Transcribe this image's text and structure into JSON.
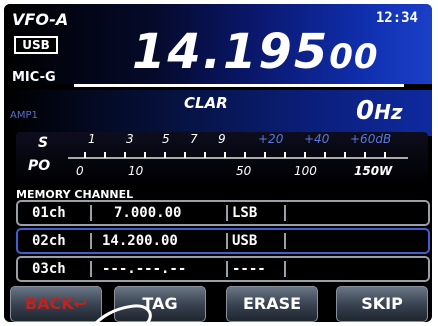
{
  "header": {
    "vfo": "VFO-A",
    "time": "12:34",
    "mode": "USB",
    "freq_main": "14.195",
    "freq_sub": "00",
    "mic_label": "MIC-G"
  },
  "clar": {
    "amp": "AMP1",
    "label": "CLAR",
    "value": "0",
    "unit": "Hz"
  },
  "meter": {
    "s_label": "S",
    "po_label": "PO",
    "s_ticks": [
      "1",
      "3",
      "5",
      "7",
      "9",
      "+20",
      "+40",
      "+60dB"
    ],
    "po_ticks": [
      "0",
      "10",
      "50",
      "100",
      "150W"
    ]
  },
  "memory": {
    "title": "MEMORY CHANNEL",
    "rows": [
      {
        "ch": "01ch",
        "freq": "7.000.00",
        "mode": "LSB",
        "tag": ""
      },
      {
        "ch": "02ch",
        "freq": "14.200.00",
        "mode": "USB",
        "tag": ""
      },
      {
        "ch": "03ch",
        "freq": "---.---.--",
        "mode": "----",
        "tag": ""
      }
    ]
  },
  "buttons": {
    "back": "BACK",
    "tag": "TAG",
    "erase": "ERASE",
    "skip": "SKIP"
  },
  "colors": {
    "accent_blue": "#1a40c8",
    "back_red": "#c0221e"
  }
}
